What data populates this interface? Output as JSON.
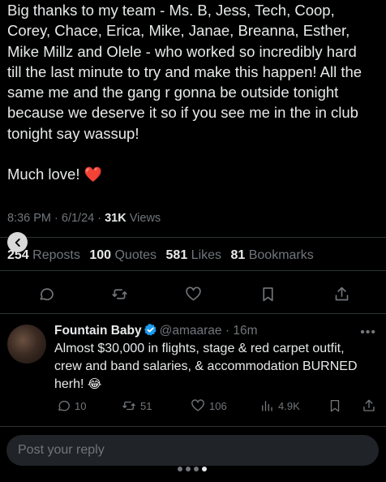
{
  "post": {
    "paragraph1": "Big thanks to my team - Ms. B, Jess, Tech, Coop,\nCorey, Chace, Erica, Mike, Janae, Breanna, Esther,\nMike Millz and Olele - who worked so incredibly hard\ntill the last minute to try and make this happen! All the\nsame me and the gang r gonna be outside tonight\nbecause we deserve it so if you see me in the in club\ntonight say wassup!",
    "paragraph2": "Much love!",
    "heart": "❤️",
    "time": "8:36 PM",
    "date": "6/1/24",
    "views_count": "31K",
    "views_label": "Views"
  },
  "stats": {
    "reposts_count": "254",
    "reposts_label": "Reposts",
    "quotes_count": "100",
    "quotes_label": "Quotes",
    "likes_count": "581",
    "likes_label": "Likes",
    "bookmarks_count": "81",
    "bookmarks_label": "Bookmarks"
  },
  "reply": {
    "name": "Fountain Baby",
    "handle": "@amaarae",
    "time": "16m",
    "text": "Almost $30,000 in flights, stage & red carpet outfit,\ncrew and band salaries, & accommodation BURNED\nherh!",
    "emoji": "😂",
    "replies": "10",
    "reposts": "51",
    "likes": "106",
    "views": "4.9K"
  },
  "composer": {
    "placeholder": "Post your reply"
  },
  "colors": {
    "background": "#000000",
    "text": "#e7e9ea",
    "muted": "#71767b",
    "verified": "#1d9bf0",
    "divider": "#2f3336"
  }
}
